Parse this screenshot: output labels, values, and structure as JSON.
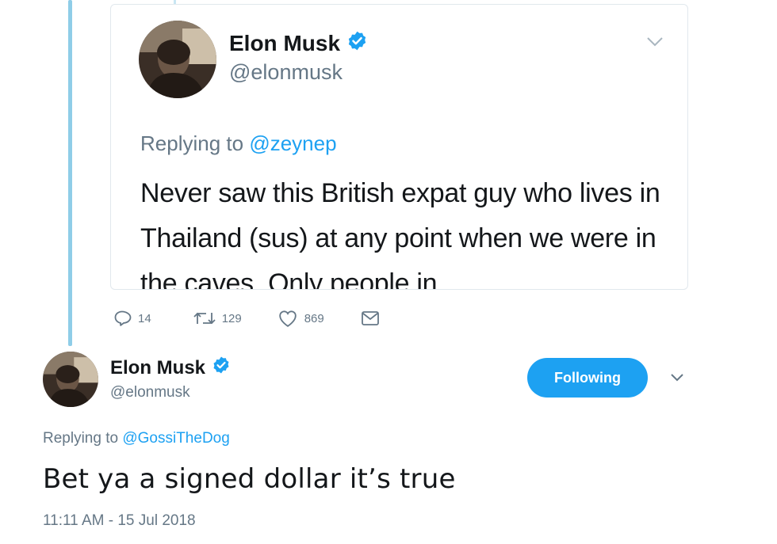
{
  "quoted_tweet": {
    "author_name": "Elon Musk",
    "author_handle": "@elonmusk",
    "replying_prefix": "Replying to",
    "replying_to": "@zeynep",
    "text": "Never saw this British expat guy who lives in Thailand (sus) at any point when we were in the caves. Only people in",
    "stats": {
      "replies": "14",
      "retweets": "129",
      "likes": "869"
    }
  },
  "main_tweet": {
    "author_name": "Elon Musk",
    "author_handle": "@elonmusk",
    "follow_label": "Following",
    "replying_prefix": "Replying to",
    "replying_to": "@GossiTheDog",
    "text": "Bet ya a signed dollar it’s true",
    "timestamp": "11:11 AM - 15 Jul 2018"
  },
  "icons": {
    "verified": "verified-badge-icon",
    "reply": "reply-icon",
    "retweet": "retweet-icon",
    "like": "heart-icon",
    "message": "envelope-icon",
    "menu": "chevron-down-icon"
  },
  "colors": {
    "accent": "#1da1f2",
    "thread_line": "#8fcde8",
    "secondary_text": "#657786",
    "primary_text": "#14171a"
  }
}
